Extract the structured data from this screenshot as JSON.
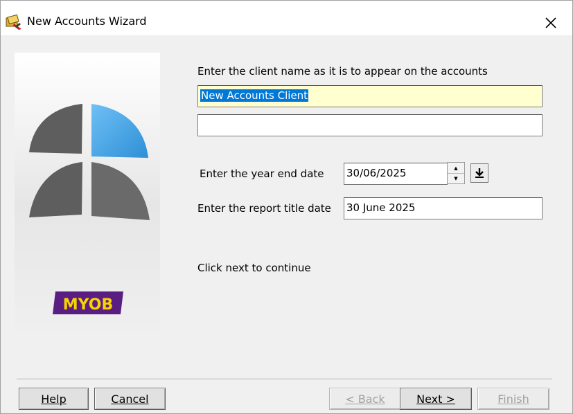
{
  "window": {
    "title": "New Accounts Wizard"
  },
  "form": {
    "client_prompt": "Enter the client name as it is to appear on the accounts",
    "client_name_line1": "New Accounts Client",
    "client_name_line2": "",
    "year_end_label": "Enter the year end date",
    "year_end_value": "30/06/2025",
    "report_title_label": "Enter the report title date",
    "report_title_value": "30 June 2025",
    "continue_hint": "Click next to continue"
  },
  "branding": {
    "logo_text": "MYOB"
  },
  "buttons": {
    "help": "Help",
    "cancel": "Cancel",
    "back": "< Back",
    "next": "Next >",
    "finish": "Finish"
  },
  "colors": {
    "selection": "#0078d7",
    "highlight_field": "#ffffd0",
    "logo_blue": "#3fa0e0",
    "logo_grey": "#5e5e5e",
    "myob_purple": "#5a1e82",
    "myob_yellow": "#f7d400"
  }
}
